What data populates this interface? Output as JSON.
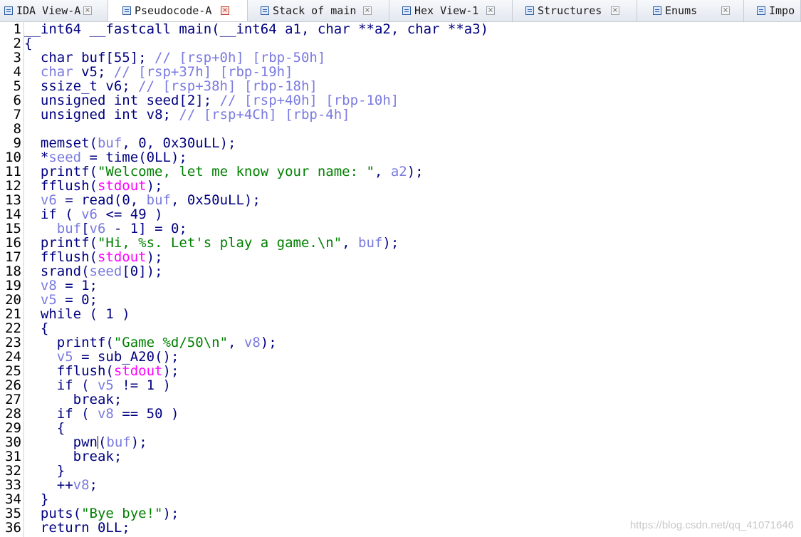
{
  "tabs": [
    {
      "label": "IDA View-A",
      "icon": "ida-view-icon"
    },
    {
      "label": "Pseudocode-A",
      "icon": "pseudocode-icon",
      "active": true
    },
    {
      "label": "Stack of main",
      "icon": "stack-icon"
    },
    {
      "label": "Hex View-1",
      "icon": "hex-view-icon"
    },
    {
      "label": "Structures",
      "icon": "structures-icon"
    },
    {
      "label": "Enums",
      "icon": "enums-icon"
    },
    {
      "label": "Impo",
      "icon": "imports-icon"
    }
  ],
  "code_lines": [
    {
      "n": "1",
      "text": "__int64 __fastcall main(__int64 a1, char **a2, char **a3)"
    },
    {
      "n": "2",
      "text": "{"
    },
    {
      "n": "3",
      "text": "  char buf[55]; // [rsp+0h] [rbp-50h]"
    },
    {
      "n": "4",
      "text": "  char v5; // [rsp+37h] [rbp-19h]"
    },
    {
      "n": "5",
      "text": "  ssize_t v6; // [rsp+38h] [rbp-18h]"
    },
    {
      "n": "6",
      "text": "  unsigned int seed[2]; // [rsp+40h] [rbp-10h]"
    },
    {
      "n": "7",
      "text": "  unsigned int v8; // [rsp+4Ch] [rbp-4h]"
    },
    {
      "n": "8",
      "text": ""
    },
    {
      "n": "9",
      "text": "  memset(buf, 0, 0x30uLL);"
    },
    {
      "n": "10",
      "text": "  *seed = time(0LL);"
    },
    {
      "n": "11",
      "text": "  printf(\"Welcome, let me know your name: \", a2);"
    },
    {
      "n": "12",
      "text": "  fflush(stdout);"
    },
    {
      "n": "13",
      "text": "  v6 = read(0, buf, 0x50uLL);"
    },
    {
      "n": "14",
      "text": "  if ( v6 <= 49 )"
    },
    {
      "n": "15",
      "text": "    buf[v6 - 1] = 0;"
    },
    {
      "n": "16",
      "text": "  printf(\"Hi, %s. Let's play a game.\\n\", buf);"
    },
    {
      "n": "17",
      "text": "  fflush(stdout);"
    },
    {
      "n": "18",
      "text": "  srand(seed[0]);"
    },
    {
      "n": "19",
      "text": "  v8 = 1;"
    },
    {
      "n": "20",
      "text": "  v5 = 0;"
    },
    {
      "n": "21",
      "text": "  while ( 1 )"
    },
    {
      "n": "22",
      "text": "  {"
    },
    {
      "n": "23",
      "text": "    printf(\"Game %d/50\\n\", v8);"
    },
    {
      "n": "24",
      "text": "    v5 = sub_A20();"
    },
    {
      "n": "25",
      "text": "    fflush(stdout);"
    },
    {
      "n": "26",
      "text": "    if ( v5 != 1 )"
    },
    {
      "n": "27",
      "text": "      break;"
    },
    {
      "n": "28",
      "text": "    if ( v8 == 50 )"
    },
    {
      "n": "29",
      "text": "    {"
    },
    {
      "n": "30",
      "text": "      pwn(buf);"
    },
    {
      "n": "31",
      "text": "      break;"
    },
    {
      "n": "32",
      "text": "    }"
    },
    {
      "n": "33",
      "text": "    ++v8;"
    },
    {
      "n": "34",
      "text": "  }"
    },
    {
      "n": "35",
      "text": "  puts(\"Bye bye!\");"
    },
    {
      "n": "36",
      "text": "  return 0LL;"
    }
  ],
  "watermark": "https://blog.csdn.net/qq_41071646",
  "colors": {
    "keyword": "#000080",
    "variable": "#7a7ae0",
    "string": "#008000",
    "global": "#ff00ff"
  }
}
